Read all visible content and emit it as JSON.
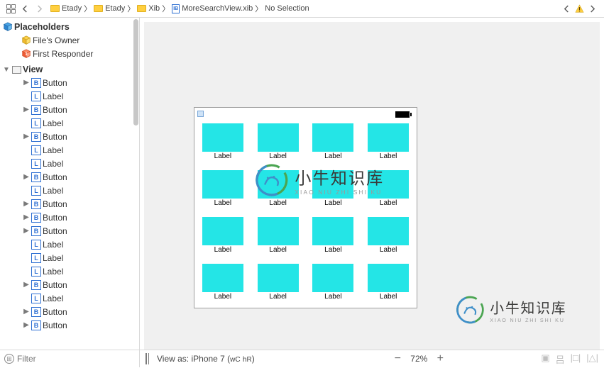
{
  "jumpbar": {
    "crumbs": [
      {
        "icon": "folder",
        "label": "Etady"
      },
      {
        "icon": "folder",
        "label": "Etady"
      },
      {
        "icon": "folder",
        "label": "Xib"
      },
      {
        "icon": "doc",
        "label": "MoreSearchView.xib"
      },
      {
        "icon": "",
        "label": "No Selection"
      }
    ]
  },
  "outline": {
    "placeholders_header": "Placeholders",
    "files_owner": "File's Owner",
    "first_responder": "First Responder",
    "view_header": "View",
    "items": [
      {
        "t": "B",
        "label": "Button",
        "disc": true
      },
      {
        "t": "L",
        "label": "Label",
        "disc": false
      },
      {
        "t": "B",
        "label": "Button",
        "disc": true
      },
      {
        "t": "L",
        "label": "Label",
        "disc": false
      },
      {
        "t": "B",
        "label": "Button",
        "disc": true
      },
      {
        "t": "L",
        "label": "Label",
        "disc": false
      },
      {
        "t": "L",
        "label": "Label",
        "disc": false
      },
      {
        "t": "B",
        "label": "Button",
        "disc": true
      },
      {
        "t": "L",
        "label": "Label",
        "disc": false
      },
      {
        "t": "B",
        "label": "Button",
        "disc": true
      },
      {
        "t": "B",
        "label": "Button",
        "disc": true
      },
      {
        "t": "B",
        "label": "Button",
        "disc": true
      },
      {
        "t": "L",
        "label": "Label",
        "disc": false
      },
      {
        "t": "L",
        "label": "Label",
        "disc": false
      },
      {
        "t": "L",
        "label": "Label",
        "disc": false
      },
      {
        "t": "B",
        "label": "Button",
        "disc": true
      },
      {
        "t": "L",
        "label": "Label",
        "disc": false
      },
      {
        "t": "B",
        "label": "Button",
        "disc": true
      },
      {
        "t": "B",
        "label": "Button",
        "disc": true
      }
    ]
  },
  "filter": {
    "placeholder": "Filter"
  },
  "bottombar": {
    "view_as": "View as: iPhone 7 (",
    "wc": "wC",
    "hr": "hR",
    "close": ")",
    "zoom": "72%"
  },
  "watermark": {
    "zh": "小牛知识库",
    "en": "XIAO NIU ZHI SHI KU"
  },
  "canvas": {
    "cell_label": "Label",
    "cells": 16
  }
}
